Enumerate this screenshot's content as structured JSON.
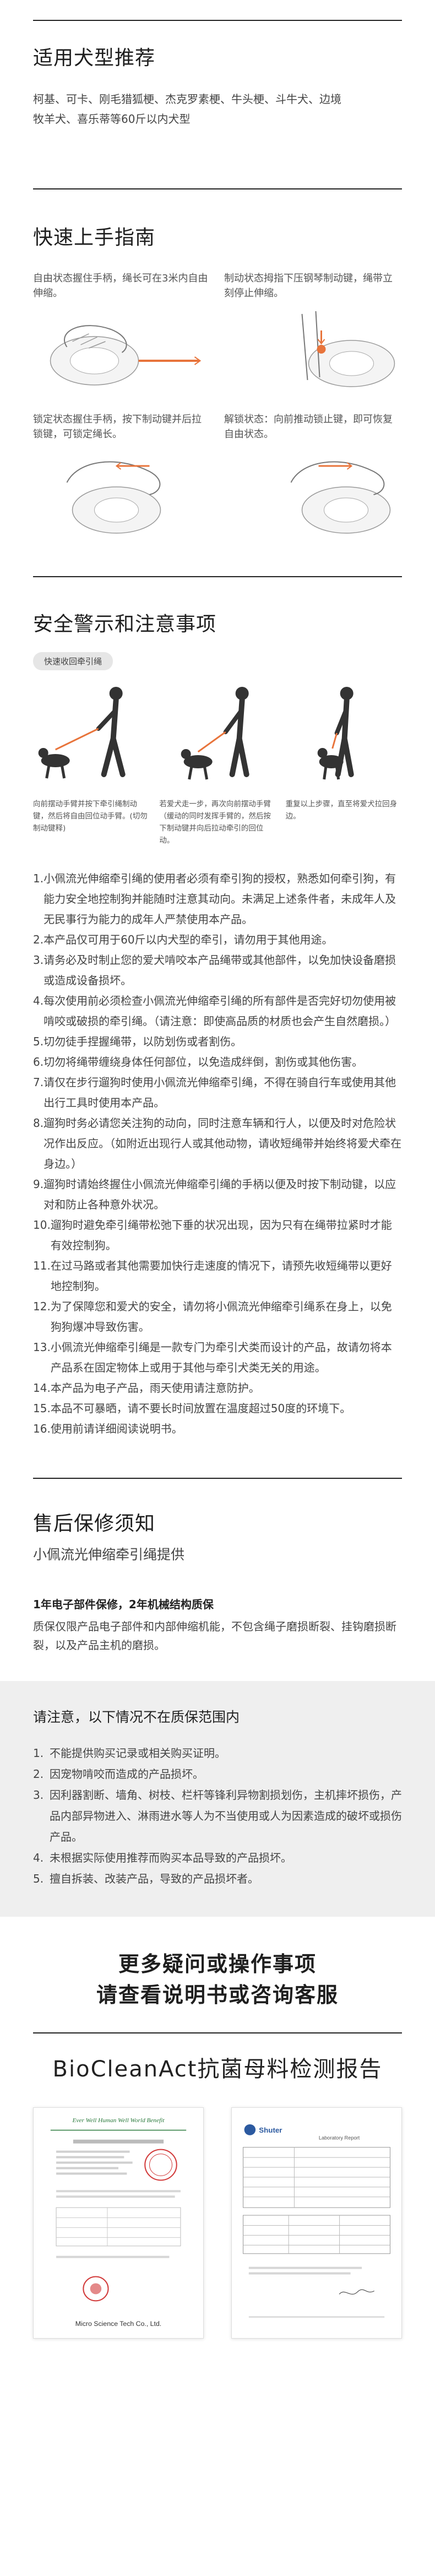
{
  "suitable": {
    "title": "适用犬型推荐",
    "body": "柯基、可卡、刚毛猎狐梗、杰克罗素梗、牛头梗、斗牛犬、边境牧羊犬、喜乐蒂等60斤以内犬型"
  },
  "guide": {
    "title": "快速上手指南",
    "steps": [
      {
        "caption": "自由状态握住手柄，绳长可在3米内自由伸缩。"
      },
      {
        "caption": "制动状态拇指下压钢琴制动键，绳带立刻停止伸缩。"
      },
      {
        "caption": "锁定状态握住手柄，按下制动键并后拉锁键，可锁定绳长。"
      },
      {
        "caption": "解锁状态：向前推动锁止键，即可恢复自由状态。"
      }
    ]
  },
  "safety": {
    "title": "安全警示和注意事项",
    "pill": "快速收回牵引绳",
    "figures": [
      {
        "caption": "向前摆动手臂并按下牵引绳制动键，然后将自由回位动手臂。(切勿制动键释)"
      },
      {
        "caption": "若爱犬走一步，再次向前摆动手臂（缓动的同时发挥手臂的，然后按下制动键并向后拉动牵引的回位动。"
      },
      {
        "caption": "重复以上步骤，直至将爱犬拉回身边。"
      }
    ],
    "items": [
      {
        "num": "1.",
        "text": "小佩流光伸缩牵引绳的使用者必须有牵引狗的授权，熟悉如何牵引狗，有能力安全地控制狗并能随时注意其动向。未满足上述条件者，未成年人及无民事行为能力的成年人严禁使用本产品。"
      },
      {
        "num": "2.",
        "text": "本产品仅可用于60斤以内犬型的牵引，请勿用于其他用途。"
      },
      {
        "num": "3.",
        "text": "请务必及时制止您的爱犬啃咬本产品绳带或其他部件，以免加快设备磨损或造成设备损坏。"
      },
      {
        "num": "4.",
        "text": "每次使用前必须检查小佩流光伸缩牵引绳的所有部件是否完好切勿使用被啃咬或破损的牵引绳。（请注意：即使高品质的材质也会产生自然磨损。）"
      },
      {
        "num": "5.",
        "text": "切勿徒手捏握绳带，以防划伤或者割伤。"
      },
      {
        "num": "6.",
        "text": "切勿将绳带缠绕身体任何部位，以免造成绊倒，割伤或其他伤害。"
      },
      {
        "num": "7.",
        "text": "请仅在步行遛狗时使用小佩流光伸缩牵引绳，不得在骑自行车或使用其他出行工具时使用本产品。"
      },
      {
        "num": "8.",
        "text": "遛狗时务必请您关注狗的动向，同时注意车辆和行人，以便及时对危险状况作出反应。（如附近出现行人或其他动物，请收短绳带并始终将爱犬牵在身边。）"
      },
      {
        "num": "9.",
        "text": "遛狗时请始终握住小佩流光伸缩牵引绳的手柄以便及时按下制动键，以应对和防止各种意外状况。"
      },
      {
        "num": "10.",
        "text": "遛狗时避免牵引绳带松弛下垂的状况出现，因为只有在绳带拉紧时才能有效控制狗。"
      },
      {
        "num": "11.",
        "text": "在过马路或者其他需要加快行走速度的情况下，请预先收短绳带以更好地控制狗。"
      },
      {
        "num": "12.",
        "text": "为了保障您和爱犬的安全，请勿将小佩流光伸缩牵引绳系在身上，以免狗狗爆冲导致伤害。"
      },
      {
        "num": "13.",
        "text": "小佩流光伸缩牵引绳是一款专门为牵引犬类而设计的产品，故请勿将本产品系在固定物体上或用于其他与牵引犬类无关的用途。"
      },
      {
        "num": "14.",
        "text": "本产品为电子产品，雨天使用请注意防护。"
      },
      {
        "num": "15.",
        "text": "本品不可暴晒，请不要长时间放置在温度超过50度的环境下。"
      },
      {
        "num": "16.",
        "text": "使用前请详细阅读说明书。"
      }
    ]
  },
  "after_sales": {
    "title": "售后保修须知",
    "subtitle": "小佩流光伸缩牵引绳提供",
    "bold": "1年电子部件保修，2年机械结构质保",
    "body": "质保仅限产品电子部件和内部伸缩机能，不包含绳子磨损断裂、挂钩磨损断裂，以及产品主机的磨损。"
  },
  "notice": {
    "title": "请注意，以下情况不在质保范围内",
    "items": [
      {
        "num": "1.",
        "text": "不能提供购买记录或相关购买证明。"
      },
      {
        "num": "2.",
        "text": "因宠物啃咬而造成的产品损坏。"
      },
      {
        "num": "3.",
        "text": "因利器割断、墙角、树枝、栏杆等锋利异物割损划伤，主机摔坏损伤，产品内部异物进入、淋雨进水等人为不当使用或人为因素造成的破坏或损伤产品。"
      },
      {
        "num": "4.",
        "text": "未根据实际使用推荐而购买本品导致的产品损坏。"
      },
      {
        "num": "5.",
        "text": "擅自拆装、改装产品，导致的产品损坏者。"
      }
    ]
  },
  "faq": {
    "line1": "更多疑问或操作事项",
    "line2": "请查看说明书或咨询客服"
  },
  "report": {
    "title": "BioCleanAct抗菌母料检测报告",
    "doc_left": {
      "header_line": "Ever Well Human Well World Benefit",
      "footer": "Micro Science Tech Co., Ltd."
    },
    "doc_right": {
      "brand": "Shuter",
      "heading": "Laboratory Report"
    }
  },
  "colors": {
    "accent_orange": "#e8743b",
    "rule": "#222222",
    "notice_bg": "#efefef",
    "stamp_red": "#d23a3a"
  }
}
